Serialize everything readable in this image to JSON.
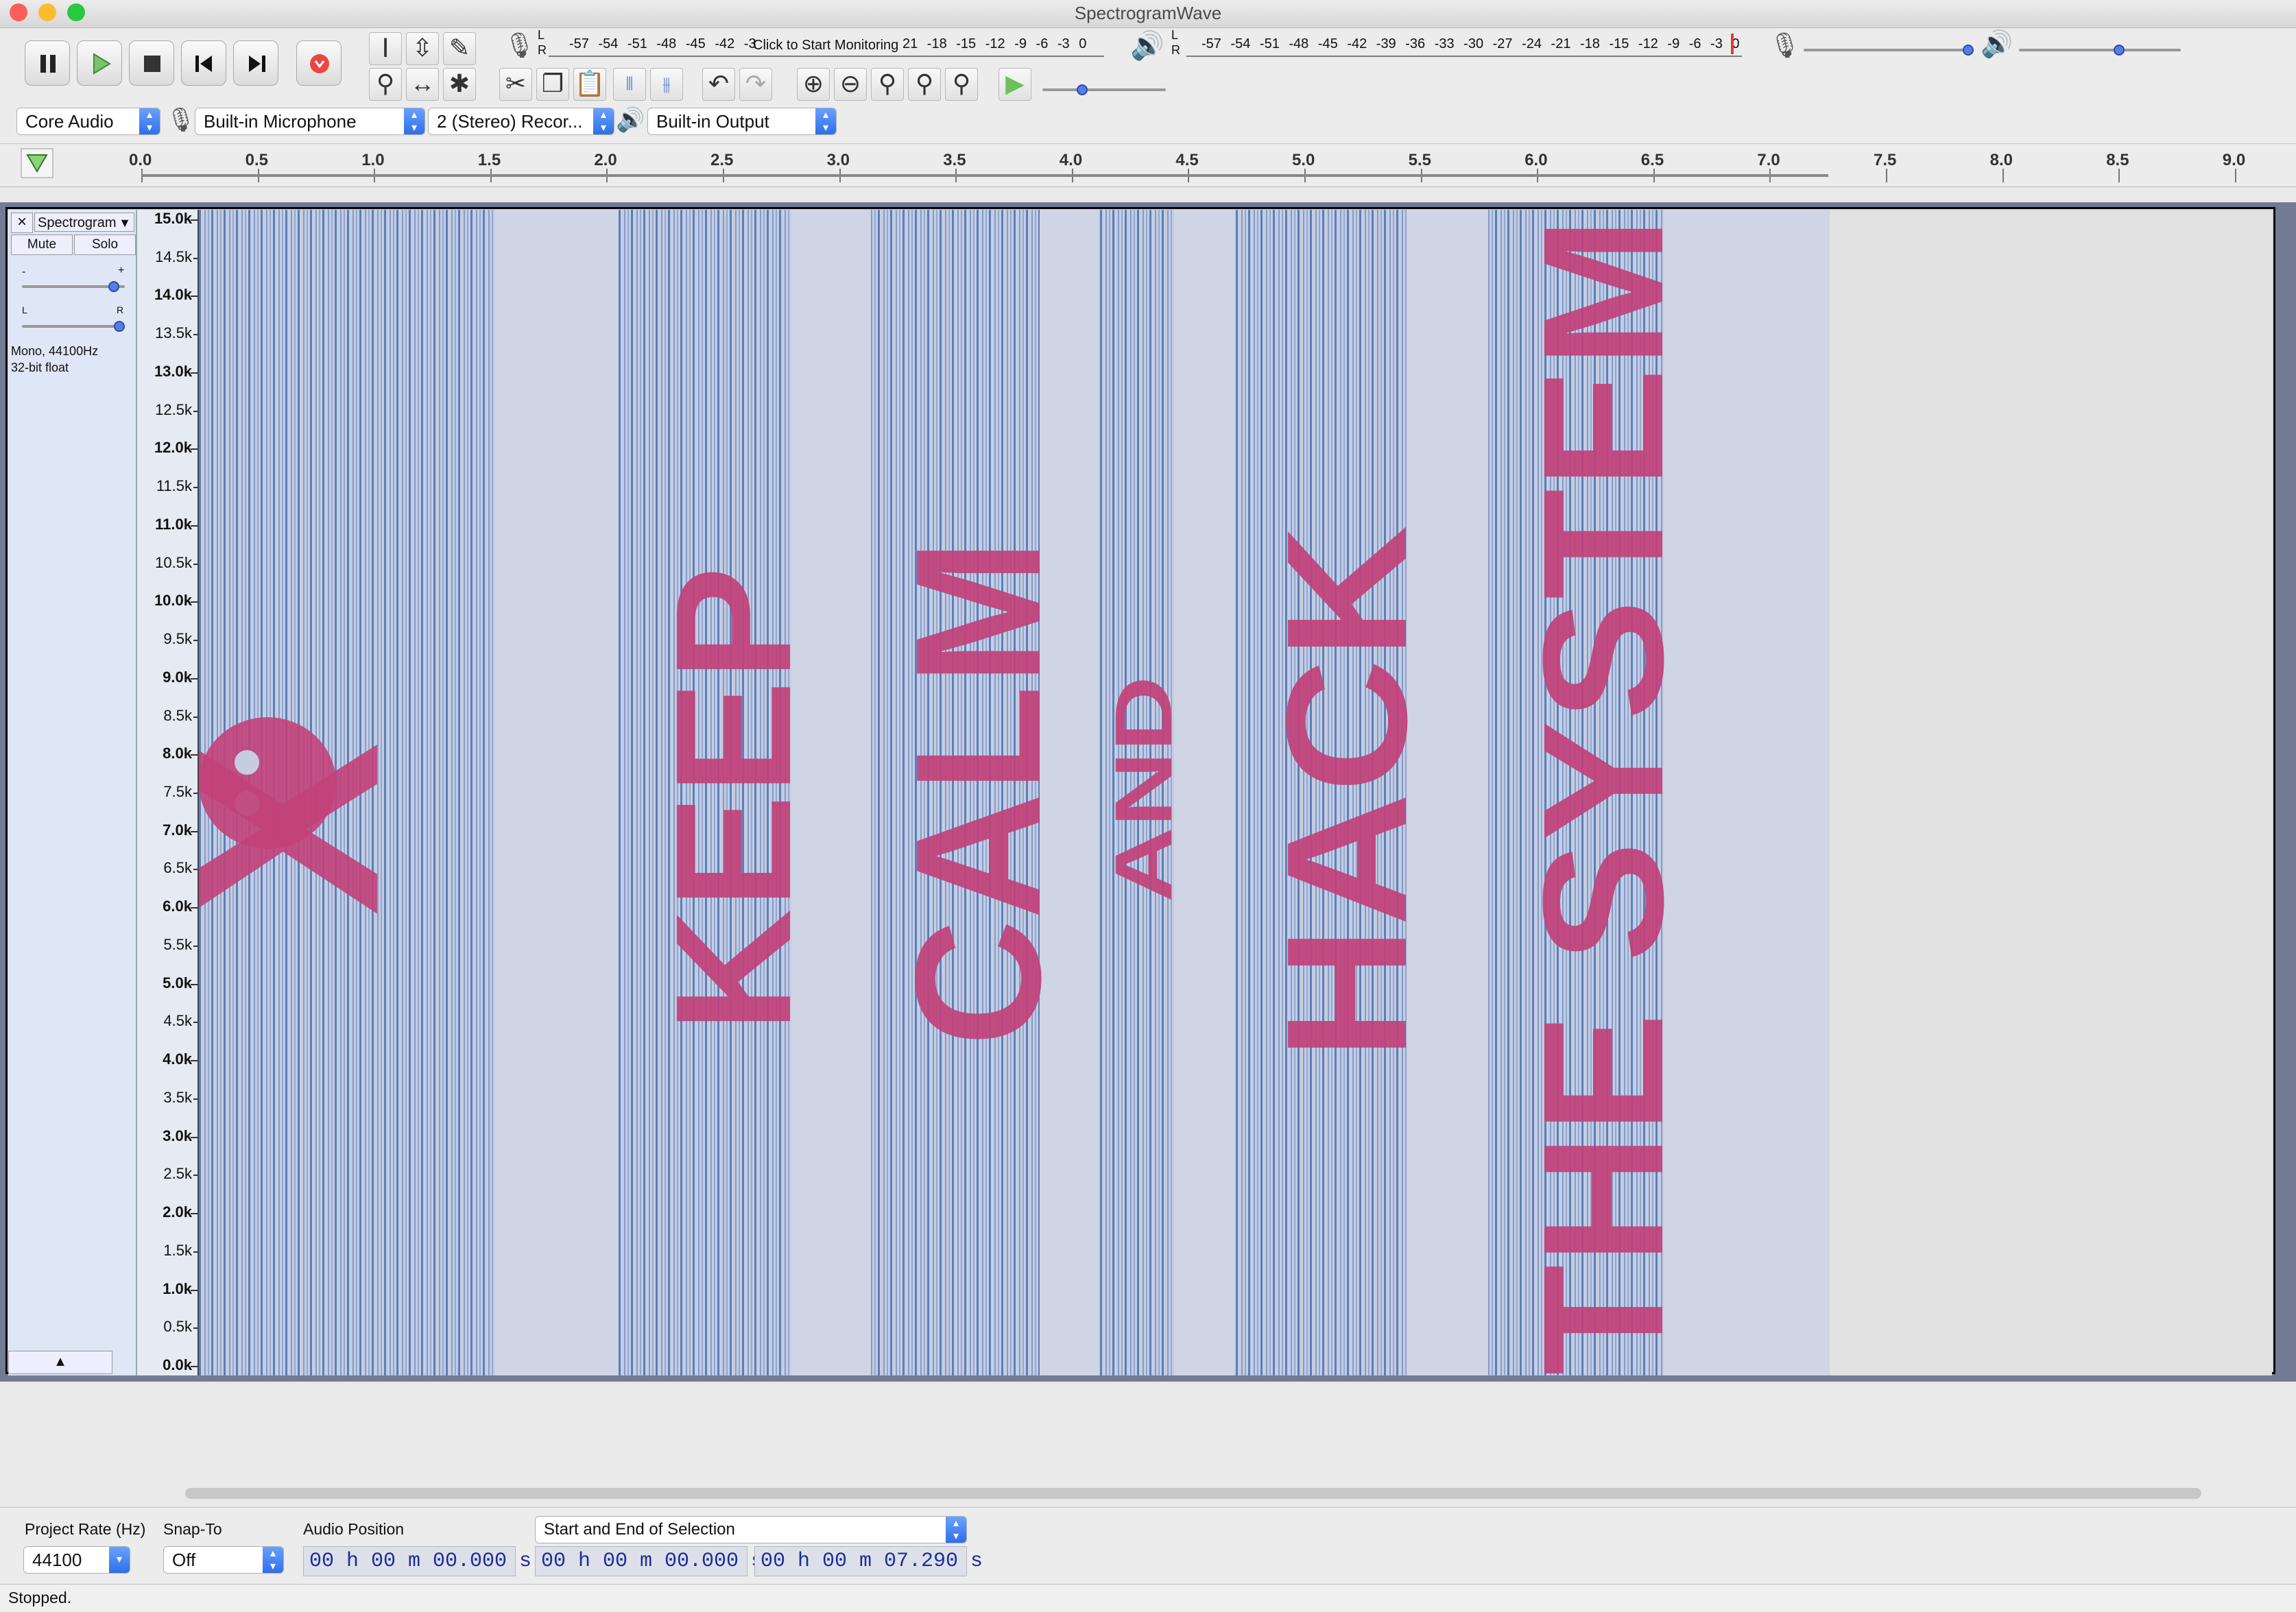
{
  "window": {
    "title": "SpectrogramWave"
  },
  "meters": {
    "record_scale": "-57 -54 -51 -48 -45 -42 -3",
    "record_prompt": "Click to Start Monitoring",
    "record_scale_tail": "21 -18 -15 -12 -9 -6 -3 0",
    "play_scale": "-57 -54 -51 -48 -45 -42 -39 -36 -33 -30 -27 -24 -21 -18 -15 -12 -9 -6 -3 0",
    "lr_top": "L",
    "lr_bottom": "R"
  },
  "device_toolbar": {
    "host": "Core Audio",
    "recording_device": "Built-in Microphone",
    "channels": "2 (Stereo) Recor...",
    "playback_device": "Built-in Output"
  },
  "ruler": {
    "labels": [
      "0.0",
      "0.5",
      "1.0",
      "1.5",
      "2.0",
      "2.5",
      "3.0",
      "3.5",
      "4.0",
      "4.5",
      "5.0",
      "5.5",
      "6.0",
      "6.5",
      "7.0",
      "7.5",
      "8.0",
      "8.5",
      "9.0"
    ]
  },
  "track": {
    "name": "Spectrogram",
    "mute_label": "Mute",
    "solo_label": "Solo",
    "gain_minus": "-",
    "gain_plus": "+",
    "pan_left": "L",
    "pan_right": "R",
    "info_line1": "Mono, 44100Hz",
    "info_line2": "32-bit float",
    "collapse_glyph": "▲",
    "close_glyph": "×"
  },
  "freq_axis": {
    "labels": [
      "15.0k",
      "14.5k",
      "14.0k",
      "13.5k",
      "13.0k",
      "12.5k",
      "12.0k",
      "11.5k",
      "11.0k",
      "10.5k",
      "10.0k",
      "9.5k",
      "9.0k",
      "8.5k",
      "8.0k",
      "7.5k",
      "7.0k",
      "6.5k",
      "6.0k",
      "5.5k",
      "5.0k",
      "4.5k",
      "4.0k",
      "3.5k",
      "3.0k",
      "2.5k",
      "2.0k",
      "1.5k",
      "1.0k",
      "0.5k",
      "0.0k"
    ]
  },
  "spectrogram_text": {
    "word1": "KEEP",
    "word2": "CALM",
    "word3": "AND",
    "word4": "HACK",
    "word5": "THE SYSTEM",
    "symbol": "X"
  },
  "selection_toolbar": {
    "project_rate_label": "Project Rate (Hz)",
    "project_rate_value": "44100",
    "snap_to_label": "Snap-To",
    "snap_to_value": "Off",
    "audio_position_label": "Audio Position",
    "audio_position": "00 h 00 m 00.000 s",
    "selection_mode": "Start and End of Selection",
    "selection_start": "00 h 00 m 00.000 s",
    "selection_end": "00 h 00 m 07.290 s"
  },
  "status": {
    "text": "Stopped."
  },
  "colors": {
    "accent": "#2f6fe8",
    "spectro_text": "#c2427a",
    "spectro_line": "#4f79b8"
  }
}
